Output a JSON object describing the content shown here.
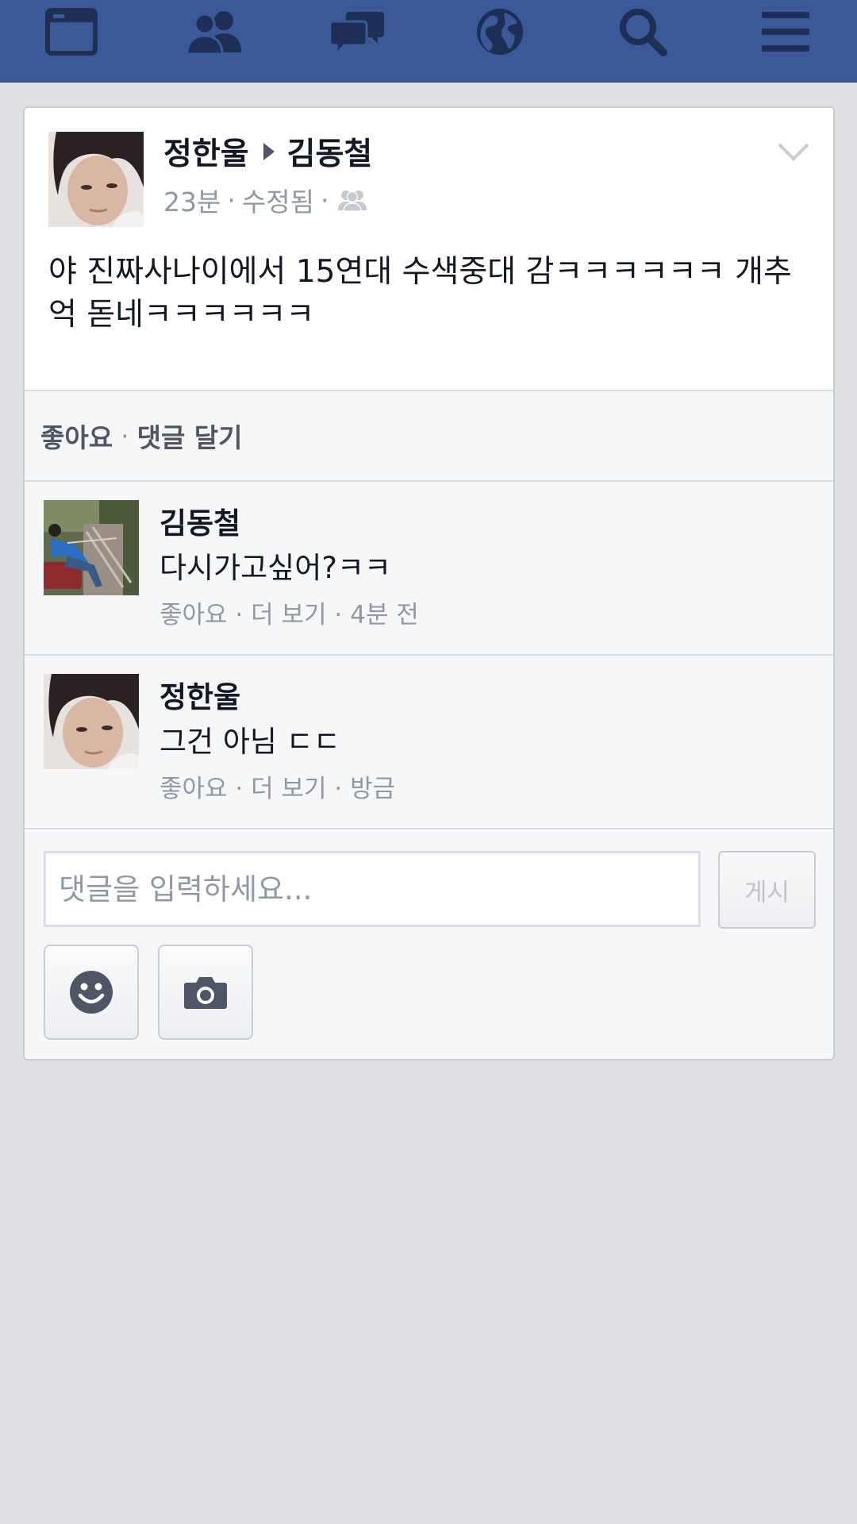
{
  "nav": {
    "icons": [
      "news-feed-icon",
      "friend-requests-icon",
      "messages-icon",
      "notifications-globe-icon",
      "search-icon",
      "menu-icon"
    ],
    "color": "#3b5998"
  },
  "post": {
    "author": "정한울",
    "target": "김동철",
    "time": "23분",
    "separator": "·",
    "edited": "수정됨",
    "audience_icon": "friends-icon",
    "text": "야 진짜사나이에서 15연대 수색중대 감ㅋㅋㅋㅋㅋㅋ 개추억 돋네ㅋㅋㅋㅋㅋㅋ"
  },
  "actions": {
    "like": "좋아요",
    "dot": "·",
    "comment": "댓글 달기"
  },
  "comments": [
    {
      "name": "김동철",
      "text": "다시가고싶어?ㅋㅋ",
      "meta": "좋아요 · 더 보기 · 4분 전"
    },
    {
      "name": "정한울",
      "text": "그건 아님 ㄷㄷ",
      "meta": "좋아요 · 더 보기 · 방금"
    }
  ],
  "composer": {
    "placeholder": "댓글을 입력하세요...",
    "post_label": "게시",
    "emoji_icon": "smiley-icon",
    "camera_icon": "camera-icon"
  }
}
